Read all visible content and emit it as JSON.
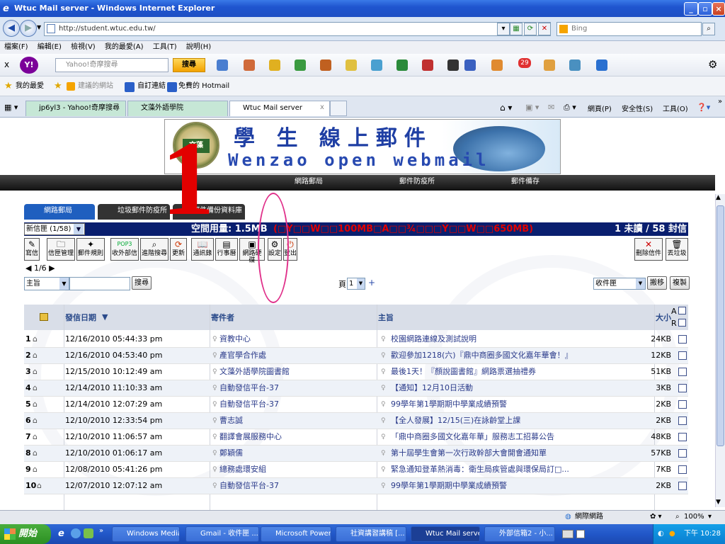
{
  "window": {
    "title": "Wtuc Mail server - Windows Internet Explorer"
  },
  "address_bar": {
    "url": "http://student.wtuc.edu.tw/",
    "search_placeholder": "Bing"
  },
  "menu": [
    "檔案(F)",
    "編輯(E)",
    "檢視(V)",
    "我的最愛(A)",
    "工具(T)",
    "說明(H)"
  ],
  "yahoo_bar": {
    "search_placeholder": "Yahoo!奇摩搜尋",
    "search_button": "搜尋",
    "mail_badge": "29"
  },
  "favorites_bar": {
    "favorites": "我的最愛",
    "suggested": "建議的網站",
    "custom_links": "自訂連結",
    "hotmail": "免費的 Hotmail"
  },
  "tabs": [
    "jp6yl3 - Yahoo!奇摩搜尋結果",
    "文藻外語學院",
    "Wtuc Mail server"
  ],
  "command_bar": {
    "page": "網頁(P)",
    "safety": "安全性(S)",
    "tools": "工具(O)"
  },
  "banner": {
    "title": "學 生 線上郵件",
    "subtitle": "Wenzao open webmail",
    "seal_text": "文藻"
  },
  "overlay_number": "1",
  "nav_black": [
    "網路郵局",
    "郵件防疫所",
    "郵件備存"
  ],
  "main_tabs": [
    "網路郵局",
    "垃圾郵件防疫所",
    "郵件備份資料庫"
  ],
  "folder": {
    "select": "新信匣 (1/58)",
    "usage": "空間用量: 1.5MB (已使用W00100MB0A00¾000Ý00W00650MB)",
    "usage_label": "空間用量: 1.5MB",
    "usage_garbled": "(□Ý□□W□□100MB□A□□¾□□□Ý□□W□□650MB)",
    "unread": "1 未讀 / 58 封信"
  },
  "toolbar": [
    "寫信",
    "信匣管理",
    "郵件規則",
    "收外部信",
    "進階搜尋",
    "更新",
    "通訊錄",
    "行事曆",
    "網路硬碟",
    "設定",
    "登出"
  ],
  "toolbar_right": [
    "刪除信件",
    "丟垃圾"
  ],
  "pager": {
    "label": "1/6"
  },
  "search": {
    "field": "主旨",
    "button": "搜尋",
    "page_label": "頁",
    "page_value": "1",
    "plus": "+",
    "target_folder": "收件匣",
    "move": "搬移",
    "copy": "複製"
  },
  "table": {
    "headers": {
      "date": "發信日期",
      "from": "寄件者",
      "subject": "主旨",
      "size": "大小",
      "a": "A",
      "r": "R"
    },
    "rows": [
      {
        "n": "1",
        "date": "12/16/2010 05:44:33 pm",
        "from": "資教中心",
        "subject": "校園網路連線及測試說明",
        "size": "24KB"
      },
      {
        "n": "2",
        "date": "12/16/2010 04:53:40 pm",
        "from": "產官學合作處",
        "subject": "歡迎參加1218(六)『鼎中商圈多國文化嘉年華會！』",
        "size": "12KB"
      },
      {
        "n": "3",
        "date": "12/15/2010 10:12:49 am",
        "from": "文藻外語學院圖書館",
        "subject": "最後1天！『顏說圖書館』網路票選抽禮券",
        "size": "51KB"
      },
      {
        "n": "4",
        "date": "12/14/2010 11:10:33 am",
        "from": "自動發信平台-37",
        "subject": "【通知】12月10日活動",
        "size": "3KB"
      },
      {
        "n": "5",
        "date": "12/14/2010 12:07:29 am",
        "from": "自動發信平台-37",
        "subject": "99學年第1學期期中學業成績預警",
        "size": "2KB"
      },
      {
        "n": "6",
        "date": "12/10/2010 12:33:54 pm",
        "from": "曹志誠",
        "subject": "【全人發展】12/15(三)在詠齡堂上課",
        "size": "2KB"
      },
      {
        "n": "7",
        "date": "12/10/2010 11:06:57 am",
        "from": "翻譯會展服務中心",
        "subject": "「鼎中商圈多國文化嘉年華」服務志工招募公告",
        "size": "48KB"
      },
      {
        "n": "8",
        "date": "12/10/2010 01:06:17 am",
        "from": "鄭穎儒",
        "subject": "第十屆學生會第一次行政幹部大會開會通知單",
        "size": "57KB"
      },
      {
        "n": "9",
        "date": "12/08/2010 05:41:26 pm",
        "from": "總務處環安組",
        "subject": "緊急通知登革熱消毒：衛生局疾管處與環保局訂□...",
        "size": "7KB"
      },
      {
        "n": "10",
        "date": "12/07/2010 12:07:12 am",
        "from": "自動發信平台-37",
        "subject": "99學年第1學期期中學業成績預警",
        "size": "2KB"
      }
    ]
  },
  "status_bar": {
    "zone": "網際網路",
    "zoom": "100%"
  },
  "taskbar": {
    "start": "開始",
    "tasks": [
      "Windows Media...",
      "Gmail - 收件匣 ...",
      "Microsoft Power...",
      "社資講習講稿 [...",
      "Wtuc Mail serve...",
      "外部信箱2 - 小..."
    ],
    "clock": "下午 10:28"
  },
  "colors": {
    "titlebar": "#1f55cf",
    "folder_row": "#0a1f6f",
    "usage_red": "#e00000",
    "annotation": "#e0308a",
    "overlay_red": "#e20000"
  }
}
